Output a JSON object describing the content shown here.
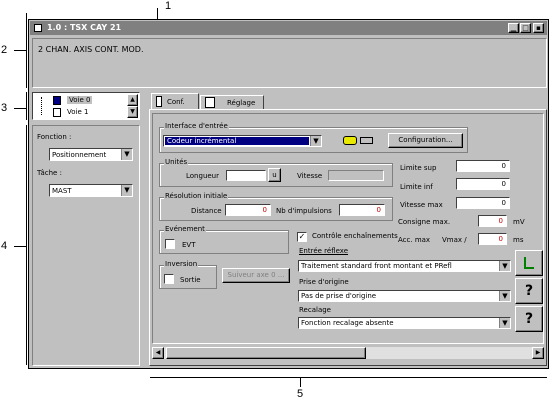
{
  "callouts": {
    "c1": "1",
    "c2": "2",
    "c3": "3",
    "c4": "4",
    "c5": "5"
  },
  "window": {
    "title": "1.0 : TSX CAY 21",
    "module_desc": "2 CHAN. AXIS CONT. MOD."
  },
  "channels": [
    {
      "label": "Voie 0"
    },
    {
      "label": "Voie 1"
    }
  ],
  "left": {
    "fonction_label": "Fonction :",
    "fonction_value": "Positionnement",
    "tache_label": "Tâche :",
    "tache_value": "MAST"
  },
  "tabs": [
    {
      "label": "Conf."
    },
    {
      "label": "Réglage"
    }
  ],
  "interface": {
    "title": "Interface d'entrée",
    "value": "Codeur incrémental",
    "config_button": "Configuration..."
  },
  "unites": {
    "title": "Unités",
    "longueur": "Longueur",
    "longueur_unit": "u",
    "vitesse": "Vitesse"
  },
  "resolution": {
    "title": "Résolution initiale",
    "distance": "Distance",
    "distance_value": "0",
    "nb_impulsions": "Nb d'impulsions",
    "nb_value": "0"
  },
  "right_fields": [
    {
      "label": "Limite sup",
      "value": "0",
      "unit": ""
    },
    {
      "label": "Limite inf",
      "value": "0",
      "unit": ""
    },
    {
      "label": "Vitesse max",
      "value": "0",
      "unit": ""
    }
  ],
  "consigne": {
    "label": "Consigne max.",
    "value": "0",
    "unit": "mV"
  },
  "acc": {
    "label": "Acc. max",
    "label2": "Vmax /",
    "value": "0",
    "unit": "ms"
  },
  "evenement": {
    "title": "Evénement",
    "evt": "EVT"
  },
  "controle": {
    "label": "Contrôle enchaînements",
    "checked": "✓"
  },
  "entree_reflexe": {
    "label": "Entrée réflexe",
    "value": "Traitement standard front montant et PRefl"
  },
  "inversion": {
    "title": "Inversion",
    "sortie": "Sortie",
    "suiveur": "Suiveur axe 0 ..."
  },
  "prise": {
    "label": "Prise d'origine",
    "value": "Pas de prise d'origine"
  },
  "recalage": {
    "label": "Recalage",
    "value": "Fonction recalage absente"
  }
}
